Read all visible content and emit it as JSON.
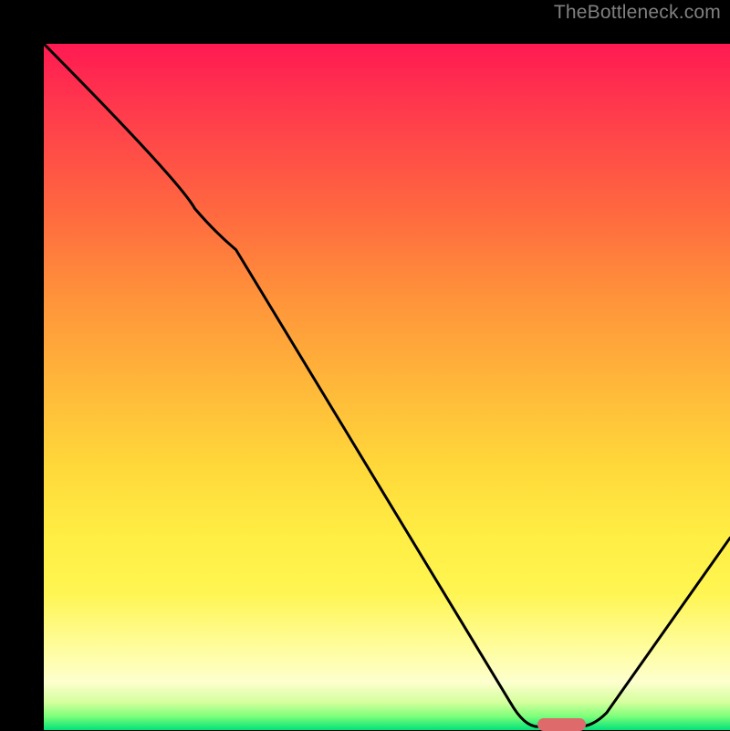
{
  "watermark": "TheBottleneck.com",
  "chart_data": {
    "type": "line",
    "title": "",
    "xlabel": "",
    "ylabel": "",
    "xlim": [
      0,
      100
    ],
    "ylim": [
      0,
      100
    ],
    "grid": false,
    "legend": false,
    "series": [
      {
        "name": "bottleneck-curve",
        "color": "#000000",
        "points": [
          {
            "x": 0,
            "y": 100
          },
          {
            "x": 22,
            "y": 76
          },
          {
            "x": 28,
            "y": 70
          },
          {
            "x": 68,
            "y": 4
          },
          {
            "x": 72,
            "y": 0.5
          },
          {
            "x": 78,
            "y": 0.5
          },
          {
            "x": 82,
            "y": 2.5
          },
          {
            "x": 100,
            "y": 28
          }
        ]
      }
    ],
    "marker": {
      "x_start": 72,
      "x_end": 79,
      "y": 0.8,
      "color": "#de6a6c"
    },
    "gradient_stops": [
      {
        "pos": 0,
        "color": "#ff1a52"
      },
      {
        "pos": 25,
        "color": "#ff6a3f"
      },
      {
        "pos": 50,
        "color": "#ffb83a"
      },
      {
        "pos": 75,
        "color": "#ffee44"
      },
      {
        "pos": 93,
        "color": "#fdffce"
      },
      {
        "pos": 100,
        "color": "#00e27a"
      }
    ]
  }
}
